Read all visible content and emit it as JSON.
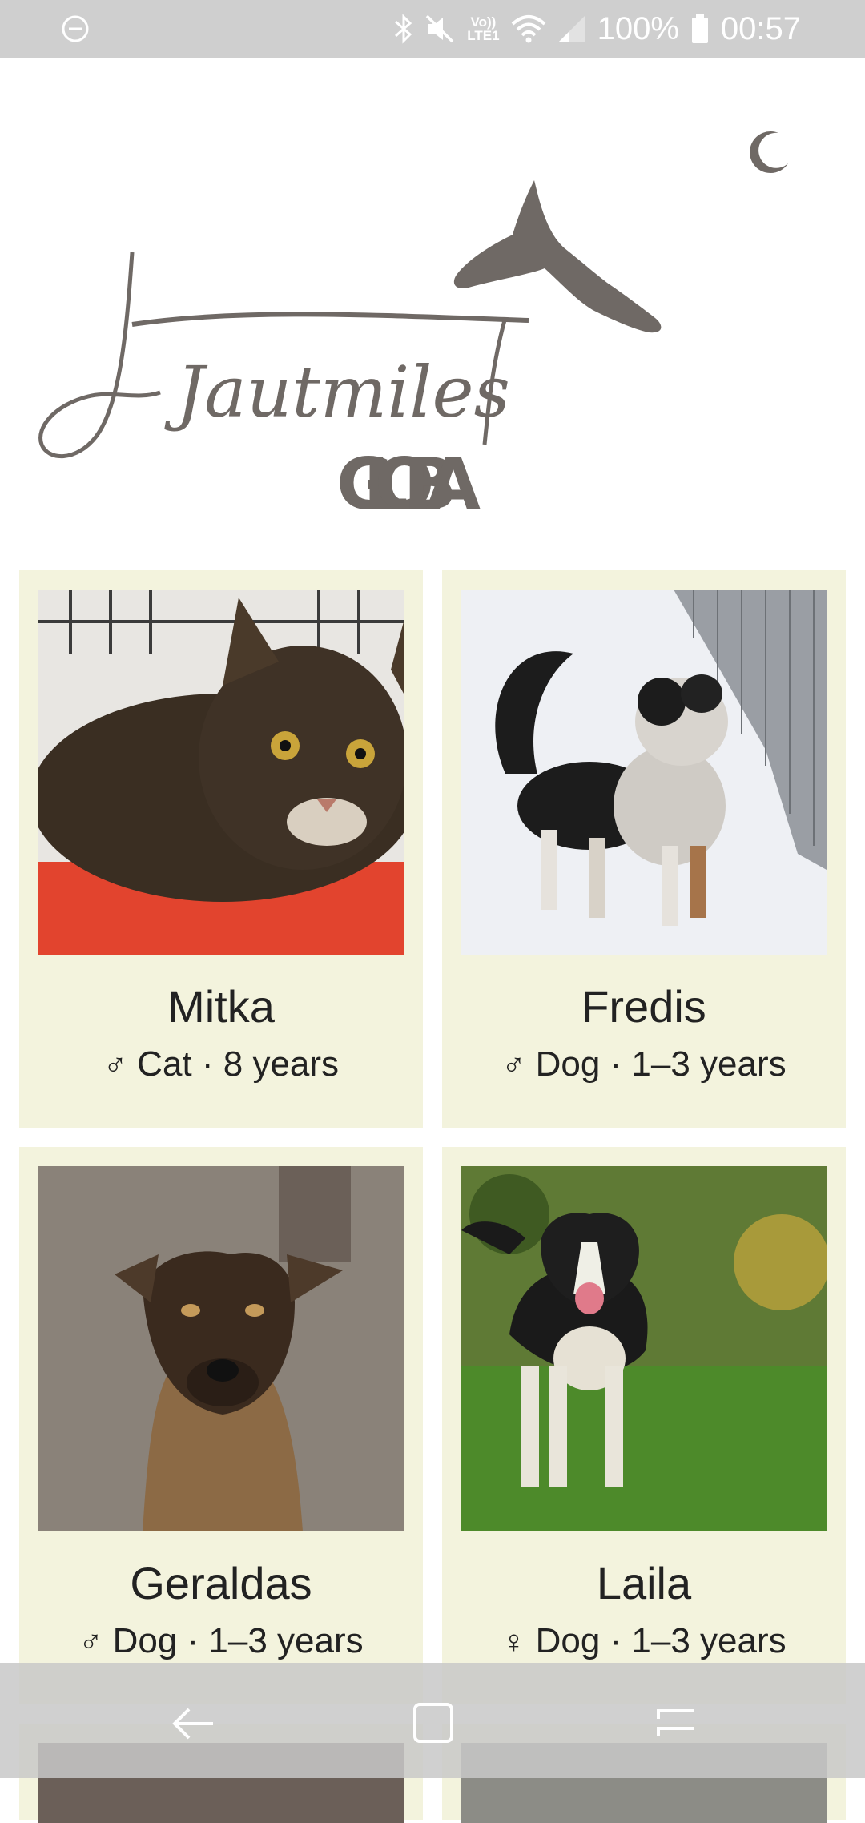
{
  "status_bar": {
    "icons": [
      "do-not-disturb-icon",
      "bluetooth-icon",
      "mute-icon",
      "volte-icon",
      "wifi-icon",
      "signal-icon",
      "battery-icon"
    ],
    "volte_label": "Vo))",
    "lte_label": "LTE1",
    "battery": "100%",
    "time": "00:57"
  },
  "header": {
    "theme_toggle_icon": "moon-icon",
    "logo_script": "Jautmiles",
    "logo_caption": "GLOBA"
  },
  "pets": [
    {
      "name": "Mitka",
      "sex_symbol": "♂",
      "details": "Cat · 8 years"
    },
    {
      "name": "Fredis",
      "sex_symbol": "♂",
      "details": "Dog · 1–3 years"
    },
    {
      "name": "Geraldas",
      "sex_symbol": "♂",
      "details": "Dog · 1–3 years"
    },
    {
      "name": "Laila",
      "sex_symbol": "♀",
      "details": "Dog · 1–3 years"
    }
  ],
  "nav_bar": {
    "icons": [
      "back-icon",
      "home-icon",
      "recents-icon"
    ]
  },
  "colors": {
    "card_bg": "#f3f3dd",
    "logo": "#6f6965",
    "status_bar_bg": "#cfcfcf"
  }
}
